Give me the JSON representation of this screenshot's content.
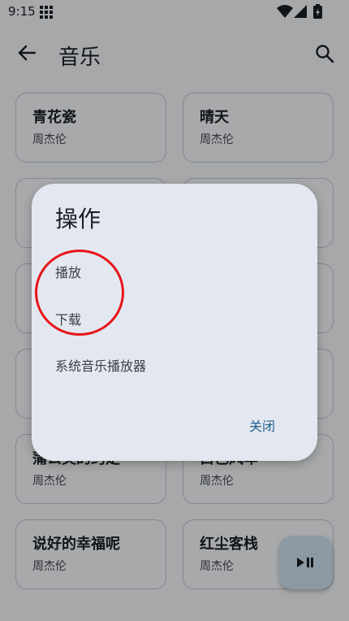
{
  "status_bar": {
    "time": "9:15"
  },
  "app_bar": {
    "title": "音乐"
  },
  "songs": [
    {
      "title": "青花瓷",
      "artist": "周杰伦"
    },
    {
      "title": "晴天",
      "artist": "周杰伦"
    },
    {
      "title": "",
      "artist": ""
    },
    {
      "title": "",
      "artist": ""
    },
    {
      "title": "",
      "artist": ""
    },
    {
      "title": "",
      "artist": ""
    },
    {
      "title": "",
      "artist": ""
    },
    {
      "title": "",
      "artist": ""
    },
    {
      "title": "蒲公英的约定",
      "artist": "周杰伦"
    },
    {
      "title": "白色风车",
      "artist": "周杰伦"
    },
    {
      "title": "说好的幸福呢",
      "artist": "周杰伦"
    },
    {
      "title": "红尘客栈",
      "artist": "周杰伦"
    }
  ],
  "dialog": {
    "title": "操作",
    "options": [
      "播放",
      "下载",
      "系统音乐播放器"
    ],
    "close_label": "关闭"
  },
  "icons": {
    "back": "arrow-back-icon",
    "search": "search-icon",
    "fab": "play-pause-icon"
  },
  "colors": {
    "dialog_bg": "#e3e8f0",
    "close_text": "#1f5f8b",
    "highlight": "#e8151b",
    "fab_bg": "#cfe3f3"
  }
}
